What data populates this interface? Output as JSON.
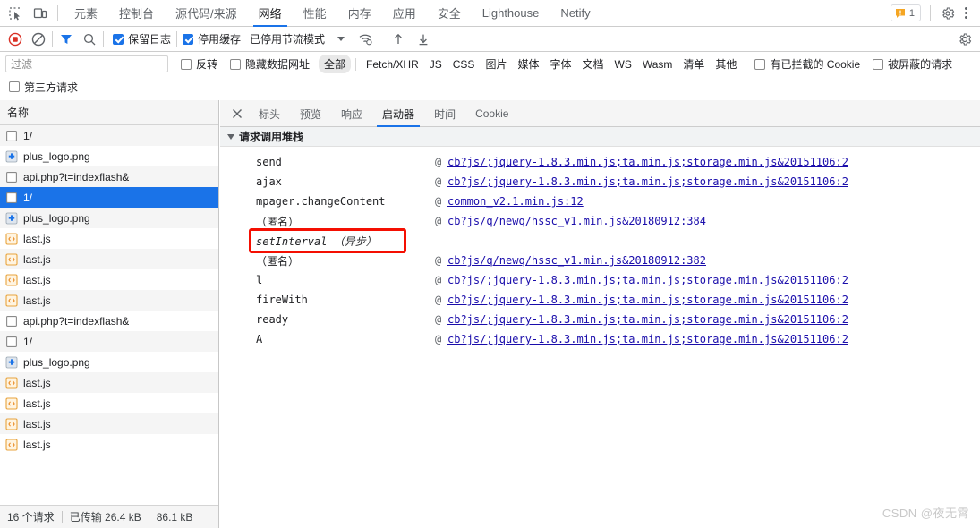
{
  "devtools": {
    "toolbar_icons": [
      "inspect-element-icon",
      "device-toolbar-icon"
    ],
    "tabs": [
      {
        "label": "元素",
        "selected": false
      },
      {
        "label": "控制台",
        "selected": false
      },
      {
        "label": "源代码/来源",
        "selected": false
      },
      {
        "label": "网络",
        "selected": true
      },
      {
        "label": "性能",
        "selected": false
      },
      {
        "label": "内存",
        "selected": false
      },
      {
        "label": "应用",
        "selected": false
      },
      {
        "label": "安全",
        "selected": false
      },
      {
        "label": "Lighthouse",
        "selected": false
      },
      {
        "label": "Netify",
        "selected": false
      }
    ],
    "warning_count": "1",
    "settings_icon": "gear-icon",
    "more_icon": "kebab-menu-icon"
  },
  "controls": {
    "record_icon": "record-stop-icon",
    "clear_icon": "clear-network-log-icon",
    "filter_icon": "filter-icon",
    "search_icon": "search-icon",
    "preserve_log": {
      "label": "保留日志",
      "checked": true
    },
    "disable_cache": {
      "label": "停用缓存",
      "checked": true
    },
    "throttle": {
      "label": "已停用节流模式"
    },
    "wifi_icon": "network-conditions-icon",
    "import_icon": "import-har-icon",
    "export_icon": "export-har-icon",
    "settings_icon": "network-settings-gear-icon"
  },
  "filters": {
    "input_placeholder": "过滤",
    "input_value": "",
    "invert": {
      "label": "反转",
      "checked": false
    },
    "hide_data_urls": {
      "label": "隐藏数据网址",
      "checked": false
    },
    "types": [
      {
        "label": "全部",
        "selected": true
      },
      {
        "label": "Fetch/XHR",
        "selected": false
      },
      {
        "label": "JS",
        "selected": false
      },
      {
        "label": "CSS",
        "selected": false
      },
      {
        "label": "图片",
        "selected": false
      },
      {
        "label": "媒体",
        "selected": false
      },
      {
        "label": "字体",
        "selected": false
      },
      {
        "label": "文档",
        "selected": false
      },
      {
        "label": "WS",
        "selected": false
      },
      {
        "label": "Wasm",
        "selected": false
      },
      {
        "label": "清单",
        "selected": false
      },
      {
        "label": "其他",
        "selected": false
      }
    ],
    "blocked_cookies": {
      "label": "有已拦截的 Cookie",
      "checked": false
    },
    "blocked_requests": {
      "label": "被屏蔽的请求",
      "checked": false
    },
    "third_party": {
      "label": "第三方请求",
      "checked": false
    }
  },
  "request_list": {
    "column_header": "名称",
    "rows": [
      {
        "name": "1/",
        "icon": "document-icon",
        "selected": false
      },
      {
        "name": "plus_logo.png",
        "icon": "image-icon",
        "selected": false
      },
      {
        "name": "api.php?t=indexflash&",
        "icon": "document-icon",
        "selected": false
      },
      {
        "name": "1/",
        "icon": "document-icon",
        "selected": true
      },
      {
        "name": "plus_logo.png",
        "icon": "image-icon",
        "selected": false
      },
      {
        "name": "last.js",
        "icon": "script-icon",
        "selected": false
      },
      {
        "name": "last.js",
        "icon": "script-icon",
        "selected": false
      },
      {
        "name": "last.js",
        "icon": "script-icon",
        "selected": false
      },
      {
        "name": "last.js",
        "icon": "script-icon",
        "selected": false
      },
      {
        "name": "api.php?t=indexflash&",
        "icon": "document-icon",
        "selected": false
      },
      {
        "name": "1/",
        "icon": "document-icon",
        "selected": false
      },
      {
        "name": "plus_logo.png",
        "icon": "image-icon",
        "selected": false
      },
      {
        "name": "last.js",
        "icon": "script-icon",
        "selected": false
      },
      {
        "name": "last.js",
        "icon": "script-icon",
        "selected": false
      },
      {
        "name": "last.js",
        "icon": "script-icon",
        "selected": false
      },
      {
        "name": "last.js",
        "icon": "script-icon",
        "selected": false
      }
    ],
    "status": {
      "requests": "16 个请求",
      "transferred": "已传输 26.4 kB",
      "resources": "86.1 kB"
    }
  },
  "detail": {
    "close_icon": "close-icon",
    "tabs": [
      {
        "label": "标头",
        "selected": false
      },
      {
        "label": "预览",
        "selected": false
      },
      {
        "label": "响应",
        "selected": false
      },
      {
        "label": "启动器",
        "selected": true
      },
      {
        "label": "时间",
        "selected": false
      },
      {
        "label": "Cookie",
        "selected": false
      }
    ],
    "section_title": "请求调用堆栈",
    "frames": [
      {
        "fn": "send",
        "at": "@",
        "link": "cb?js/;jquery-1.8.3.min.js;ta.min.js;storage.min.js&20151106:2",
        "async": false
      },
      {
        "fn": "ajax",
        "at": "@",
        "link": "cb?js/;jquery-1.8.3.min.js;ta.min.js;storage.min.js&20151106:2",
        "async": false
      },
      {
        "fn": "mpager.changeContent",
        "at": "@",
        "link": "common_v2.1.min.js:12",
        "async": false
      },
      {
        "fn": "（匿名）",
        "at": "@",
        "link": "cb?js/q/newq/hssc_v1.min.js&20180912:384",
        "async": false
      },
      {
        "fn": "setInterval （异步）",
        "at": "",
        "link": "",
        "async": true,
        "highlighted": true
      },
      {
        "fn": "（匿名）",
        "at": "@",
        "link": "cb?js/q/newq/hssc_v1.min.js&20180912:382",
        "async": false
      },
      {
        "fn": "l",
        "at": "@",
        "link": "cb?js/;jquery-1.8.3.min.js;ta.min.js;storage.min.js&20151106:2",
        "async": false
      },
      {
        "fn": "fireWith",
        "at": "@",
        "link": "cb?js/;jquery-1.8.3.min.js;ta.min.js;storage.min.js&20151106:2",
        "async": false
      },
      {
        "fn": "ready",
        "at": "@",
        "link": "cb?js/;jquery-1.8.3.min.js;ta.min.js;storage.min.js&20151106:2",
        "async": false
      },
      {
        "fn": "A",
        "at": "@",
        "link": "cb?js/;jquery-1.8.3.min.js;ta.min.js;storage.min.js&20151106:2",
        "async": false
      }
    ]
  },
  "watermark": "CSDN @夜无霄",
  "colors": {
    "accent": "#1a73e8",
    "link": "#1a0dab",
    "annotation": "#f40f02",
    "record": "#d93025"
  }
}
